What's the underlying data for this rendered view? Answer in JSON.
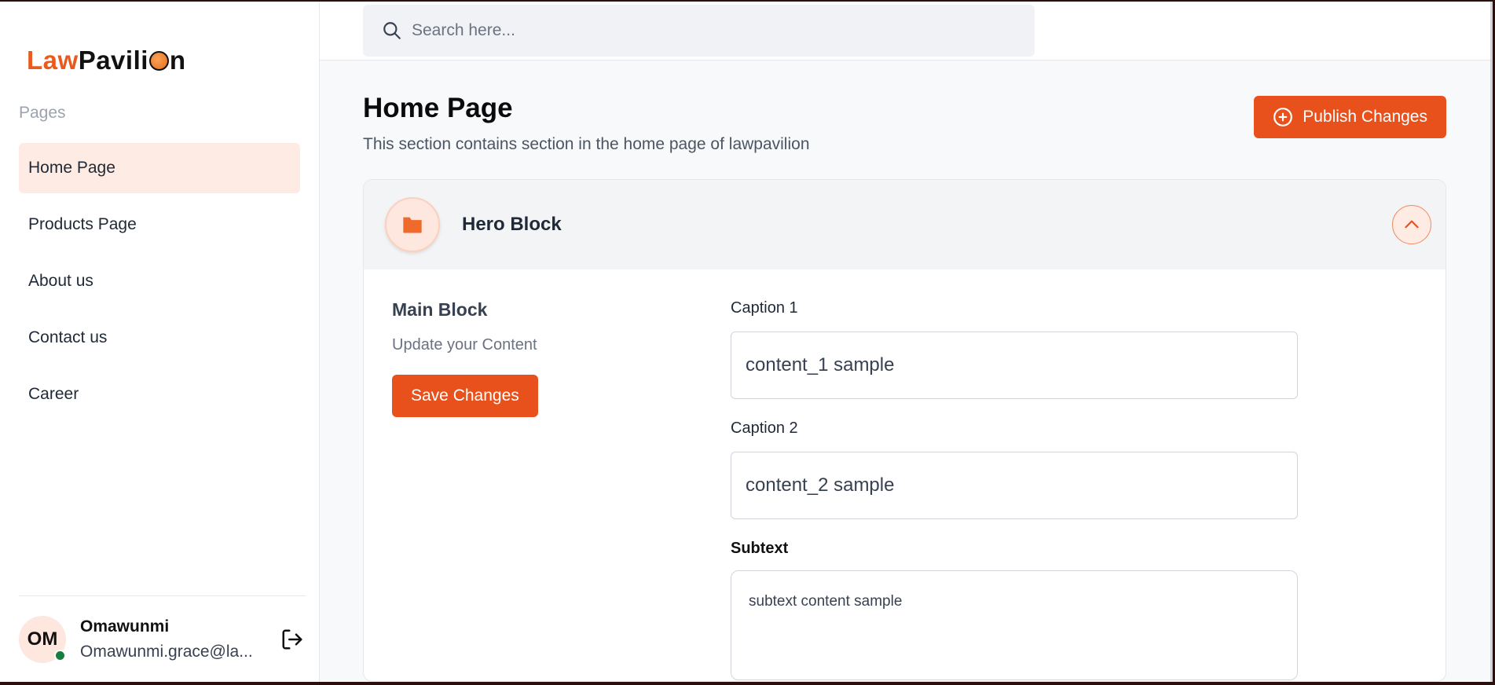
{
  "brand": {
    "part1": "Law",
    "part2": "Pavili",
    "part3": "n"
  },
  "sidebar": {
    "heading": "Pages",
    "items": [
      {
        "label": "Home Page",
        "active": true
      },
      {
        "label": "Products Page",
        "active": false
      },
      {
        "label": "About us",
        "active": false
      },
      {
        "label": "Contact us",
        "active": false
      },
      {
        "label": "Career",
        "active": false
      }
    ],
    "user": {
      "initials": "OM",
      "name": "Omawunmi",
      "email": "Omawunmi.grace@la...",
      "status_color": "#15803d"
    }
  },
  "search": {
    "placeholder": "Search here...",
    "value": ""
  },
  "page": {
    "title": "Home Page",
    "subtitle": "This section contains section in the home page of lawpavilion",
    "publish_label": "Publish Changes"
  },
  "card": {
    "title": "Hero Block",
    "block_title": "Main Block",
    "block_subtitle": "Update your Content",
    "save_label": "Save Changes",
    "fields": {
      "caption1": {
        "label": "Caption 1",
        "value": "content_1 sample"
      },
      "caption2": {
        "label": "Caption 2",
        "value": "content_2 sample"
      },
      "subtext": {
        "label": "Subtext",
        "value": "subtext content sample"
      }
    }
  },
  "colors": {
    "accent": "#e8511c",
    "active_bg": "#fdebe4"
  },
  "icons": {
    "search": "search-icon",
    "plus_circle": "plus-circle-icon",
    "folder": "folder-icon",
    "chevron_up": "chevron-up-icon",
    "logout": "logout-icon"
  }
}
